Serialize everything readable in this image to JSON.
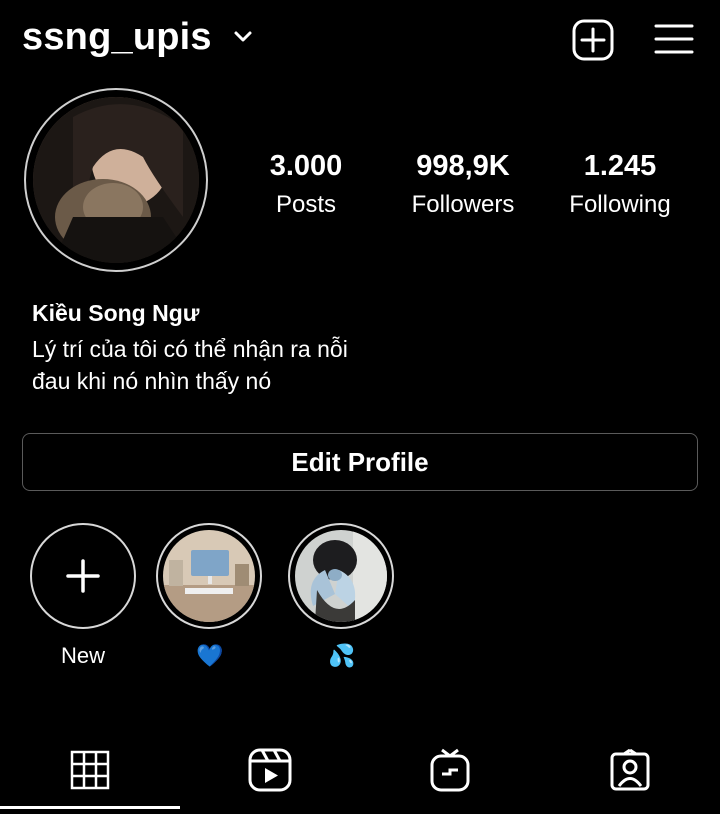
{
  "header": {
    "username": "ssng_upis",
    "icons": {
      "dropdown": "chevron-down-icon",
      "create": "plus-square-icon",
      "menu": "hamburger-menu-icon"
    }
  },
  "profile": {
    "stats": [
      {
        "value": "3.000",
        "label": "Posts"
      },
      {
        "value": "998,9K",
        "label": "Followers"
      },
      {
        "value": "1.245",
        "label": "Following"
      }
    ],
    "name": "Kiều Song Ngư",
    "bio_lines": [
      "Lý trí của tôi có thể nhận ra nỗi",
      "đau khi nó nhìn thấy nó"
    ]
  },
  "edit_profile_label": "Edit Profile",
  "highlights": [
    {
      "label": "New"
    },
    {
      "label": "💙"
    },
    {
      "label": "💦"
    }
  ],
  "tabs": [
    {
      "icon": "grid-icon",
      "active": true
    },
    {
      "icon": "reels-icon",
      "active": false
    },
    {
      "icon": "igtv-icon",
      "active": false
    },
    {
      "icon": "tagged-icon",
      "active": false
    }
  ]
}
